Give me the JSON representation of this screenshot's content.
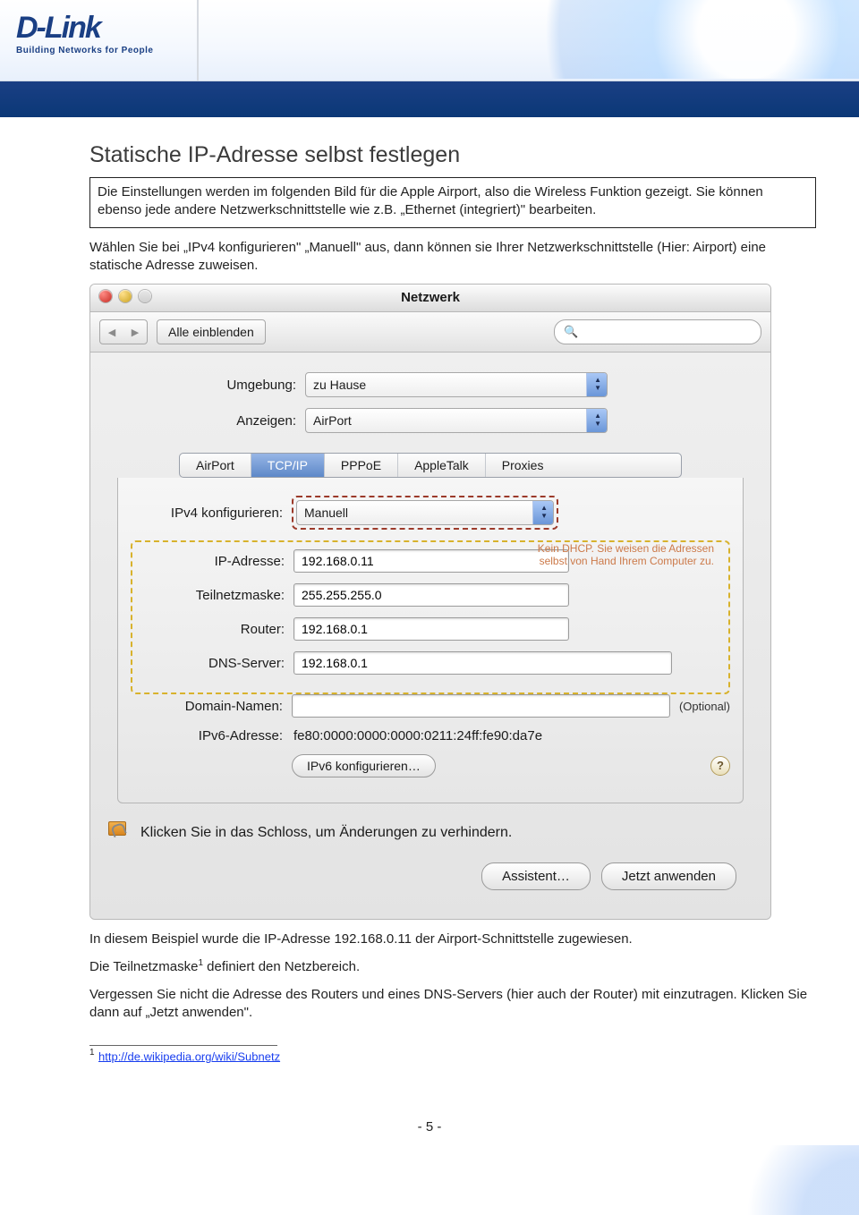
{
  "header": {
    "brand": "D-Link",
    "tagline": "Building Networks for People"
  },
  "doc": {
    "heading": "Statische IP-Adresse selbst festlegen",
    "notebox": "Die Einstellungen werden im folgenden Bild für die Apple Airport, also die Wireless Funktion gezeigt. Sie können ebenso jede andere Netzwerkschnittstelle wie z.B. „Ethernet (integriert)\" bearbeiten.",
    "intro": "Wählen Sie bei „IPv4 konfigurieren\" „Manuell\" aus, dann können sie Ihrer Netzwerkschnittstelle (Hier: Airport) eine statische Adresse zuweisen.",
    "outro1": "In diesem Beispiel wurde die IP-Adresse 192.168.0.11 der Airport-Schnittstelle zugewiesen.",
    "outro2_a": "Die Teilnetzmaske",
    "outro2_b": " definiert den Netzbereich.",
    "outro3": "Vergessen Sie nicht die Adresse des Routers und eines DNS-Servers (hier auch der Router) mit einzutragen. Klicken Sie dann auf „Jetzt anwenden\".",
    "footnote_url": "http://de.wikipedia.org/wiki/Subnetz",
    "page_number": "- 5 -"
  },
  "mac": {
    "window_title": "Netzwerk",
    "show_all": "Alle einblenden",
    "umgebung_label": "Umgebung:",
    "umgebung_value": "zu Hause",
    "anzeigen_label": "Anzeigen:",
    "anzeigen_value": "AirPort",
    "tabs": [
      "AirPort",
      "TCP/IP",
      "PPPoE",
      "AppleTalk",
      "Proxies"
    ],
    "active_tab": "TCP/IP",
    "ipv4_konfig_label": "IPv4 konfigurieren:",
    "ipv4_konfig_value": "Manuell",
    "hint_line1": "Kein DHCP. Sie weisen die Adressen",
    "hint_line2": "selbst von Hand Ihrem Computer zu.",
    "ip_label": "IP-Adresse:",
    "ip_value": "192.168.0.11",
    "mask_label": "Teilnetzmaske:",
    "mask_value": "255.255.255.0",
    "router_label": "Router:",
    "router_value": "192.168.0.1",
    "dns_label": "DNS-Server:",
    "dns_value": "192.168.0.1",
    "domain_label": "Domain-Namen:",
    "domain_value": "",
    "optional": "(Optional)",
    "ipv6_label": "IPv6-Adresse:",
    "ipv6_value": "fe80:0000:0000:0000:0211:24ff:fe90:da7e",
    "ipv6_button": "IPv6 konfigurieren…",
    "lock_text": "Klicken Sie in das Schloss, um Änderungen zu verhindern.",
    "assistant_button": "Assistent…",
    "apply_button": "Jetzt anwenden"
  }
}
